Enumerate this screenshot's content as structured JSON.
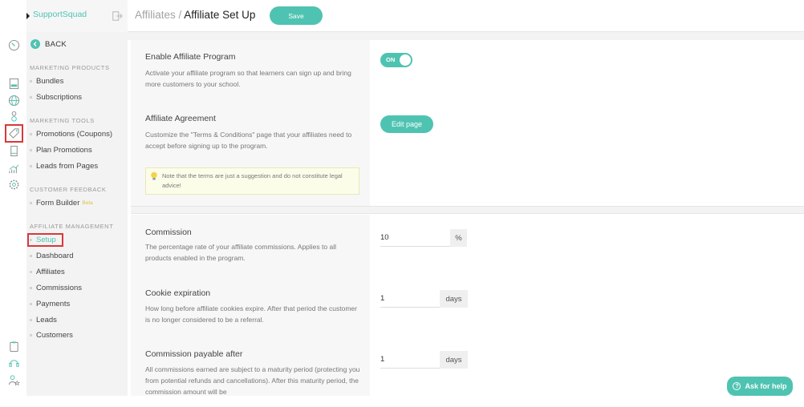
{
  "brand": {
    "name": "SupportSquad",
    "logo_icon": "diamond-logo-icon",
    "exit_icon": "logout-icon"
  },
  "rail": {
    "icons": [
      {
        "name": "dashboard-gauge-icon"
      },
      {
        "name": "courses-icon"
      },
      {
        "name": "globe-icon"
      },
      {
        "name": "users-icon"
      },
      {
        "name": "tag-icon",
        "selected": true
      },
      {
        "name": "mobile-icon"
      },
      {
        "name": "analytics-icon"
      },
      {
        "name": "settings-gear-icon"
      },
      {
        "name": "clipboard-icon"
      },
      {
        "name": "headset-support-icon"
      },
      {
        "name": "user-star-icon"
      }
    ]
  },
  "menu": {
    "back_label": "BACK",
    "sections": [
      {
        "title": "MARKETING PRODUCTS",
        "items": [
          "Bundles",
          "Subscriptions"
        ]
      },
      {
        "title": "MARKETING TOOLS",
        "items": [
          "Promotions (Coupons)",
          "Plan Promotions",
          "Leads from Pages"
        ]
      },
      {
        "title": "CUSTOMER FEEDBACK",
        "items": [
          "Form Builder"
        ],
        "badge": "Beta"
      },
      {
        "title": "AFFILIATE MANAGEMENT",
        "items": [
          "Setup",
          "Dashboard",
          "Affiliates",
          "Commissions",
          "Payments",
          "Leads",
          "Customers"
        ],
        "active": "Setup"
      }
    ]
  },
  "header": {
    "breadcrumb_parent": "Affiliates",
    "breadcrumb_sep": " / ",
    "breadcrumb_current": "Affiliate Set Up",
    "save_label": "Save"
  },
  "settings": {
    "enable": {
      "title": "Enable Affiliate Program",
      "desc": "Activate your affiliate program so that learners can sign up and bring more customers to your school.",
      "toggle_label": "ON",
      "toggle_on": true
    },
    "agreement": {
      "title": "Affiliate Agreement",
      "desc": "Customize the \"Terms & Conditions\" page that your affiliates need to accept before signing up to the program.",
      "button_label": "Edit page",
      "note": "Note that the terms are just a suggestion and do not constitute legal advice!"
    },
    "commission": {
      "title": "Commission",
      "desc": "The percentage rate of your affiliate commissions. Applies to all products enabled in the program.",
      "value": "10",
      "unit": "%"
    },
    "cookie": {
      "title": "Cookie expiration",
      "desc": "How long before affiliate cookies expire. After that period the customer is no longer considered to be a referral.",
      "value": "1",
      "unit": "days"
    },
    "payable": {
      "title": "Commission payable after",
      "desc": "All commissions earned are subject to a maturity period (protecting you from potential refunds and cancellations). After this maturity period, the commission amount will be",
      "value": "1",
      "unit": "days"
    }
  },
  "help": {
    "label": "Ask for help",
    "icon": "?"
  },
  "colors": {
    "accent": "#4fc3b1",
    "highlight_box": "#d93838",
    "beta": "#d8c24a"
  }
}
